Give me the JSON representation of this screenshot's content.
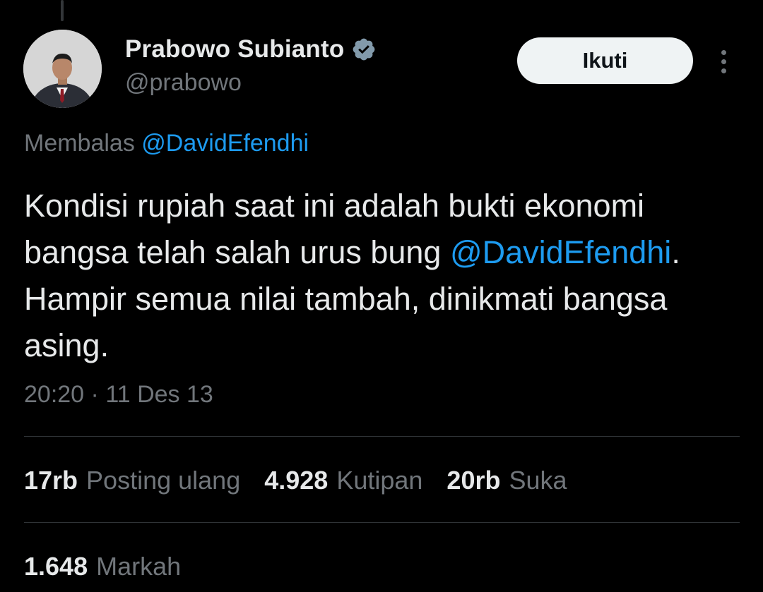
{
  "author": {
    "name": "Prabowo Subianto",
    "handle": "@prabowo",
    "verified": true
  },
  "follow_button": {
    "label": "Ikuti"
  },
  "more_icon": "more-vertical-icon",
  "reply_to": {
    "prefix": "Membalas",
    "mention": "@DavidEfendhi"
  },
  "tweet": {
    "text_part1": "Kondisi rupiah saat ini adalah bukti ekonomi bangsa telah salah urus bung ",
    "mention": "@DavidEfendhi",
    "text_part2": ". Hampir semua nilai tambah, dinikmati bangsa asing."
  },
  "timestamp": {
    "time": "20:20",
    "separator": "·",
    "date": "11 Des 13"
  },
  "stats": [
    {
      "value": "17rb",
      "label": "Posting ulang"
    },
    {
      "value": "4.928",
      "label": "Kutipan"
    },
    {
      "value": "20rb",
      "label": "Suka"
    },
    {
      "value": "1.648",
      "label": "Markah"
    }
  ],
  "colors": {
    "background": "#000000",
    "text": "#e7e9ea",
    "muted": "#71767b",
    "accent": "#1d9bf0",
    "divider": "#2f3336"
  }
}
